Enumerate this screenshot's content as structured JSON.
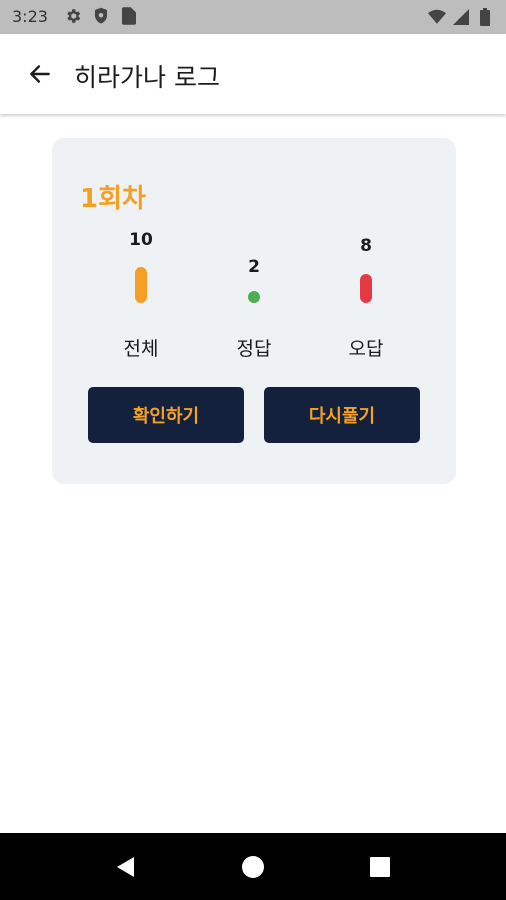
{
  "status_bar": {
    "time": "3:23",
    "left_icons": [
      "gear-icon",
      "shield-icon",
      "sim-card-icon"
    ],
    "right_icons": [
      "wifi-icon",
      "signal-icon",
      "battery-icon"
    ]
  },
  "app_bar": {
    "title": "히라가나 로그",
    "back_icon": "arrow-left-icon"
  },
  "card": {
    "round_title": "1회차",
    "stats": [
      {
        "key": "total",
        "label": "전체",
        "value": "10",
        "color": "#f5a023"
      },
      {
        "key": "correct",
        "label": "정답",
        "value": "2",
        "color": "#4caf50"
      },
      {
        "key": "wrong",
        "label": "오답",
        "value": "8",
        "color": "#e53945"
      }
    ],
    "buttons": {
      "check_label": "확인하기",
      "retry_label": "다시풀기"
    }
  },
  "colors": {
    "accent": "#f5a023",
    "button_bg": "#14213d",
    "card_bg": "#eef2f5"
  },
  "nav_bar": {
    "icons": [
      "back-triangle-icon",
      "home-circle-icon",
      "recents-square-icon"
    ]
  }
}
